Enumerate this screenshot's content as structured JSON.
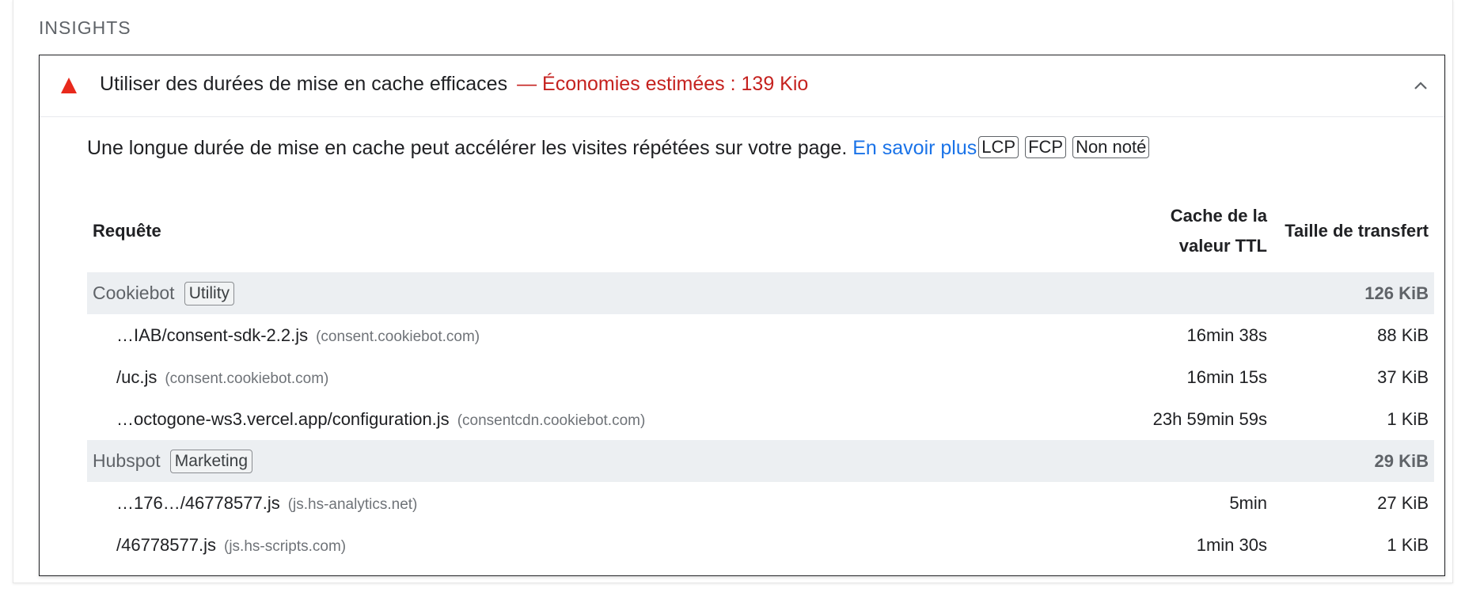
{
  "section": {
    "title": "INSIGHTS"
  },
  "audit": {
    "title": "Utiliser des durées de mise en cache efficaces",
    "savings": "— Économies estimées : 139 Kio",
    "description": "Une longue durée de mise en cache peut accélérer les visites répétées sur votre page.",
    "learn_more": "En savoir plus",
    "tags": [
      "LCP",
      "FCP",
      "Non noté"
    ],
    "status_color": "#e8291c",
    "savings_color": "#c5221f",
    "link_color": "#1a73e8"
  },
  "table": {
    "headers": {
      "request": "Requête",
      "ttl_line1": "Cache de la",
      "ttl_line2": "valeur TTL",
      "size": "Taille de transfert"
    },
    "groups": [
      {
        "name": "Cookiebot",
        "tag": "Utility",
        "size": "126 KiB",
        "rows": [
          {
            "url": "…IAB/consent-sdk-2.2.js",
            "host": "(consent.cookiebot.com)",
            "ttl": "16min 38s",
            "size": "88 KiB"
          },
          {
            "url": "/uc.js",
            "host": "(consent.cookiebot.com)",
            "ttl": "16min 15s",
            "size": "37 KiB"
          },
          {
            "url": "…octogone-ws3.vercel.app/configuration.js",
            "host": "(consentcdn.cookiebot.com)",
            "ttl": "23h 59min 59s",
            "size": "1 KiB"
          }
        ]
      },
      {
        "name": "Hubspot",
        "tag": "Marketing",
        "size": "29 KiB",
        "rows": [
          {
            "url": "…176…/46778577.js",
            "host": "(js.hs-analytics.net)",
            "ttl": "5min",
            "size": "27 KiB"
          },
          {
            "url": "/46778577.js",
            "host": "(js.hs-scripts.com)",
            "ttl": "1min 30s",
            "size": "1 KiB"
          }
        ]
      }
    ]
  }
}
